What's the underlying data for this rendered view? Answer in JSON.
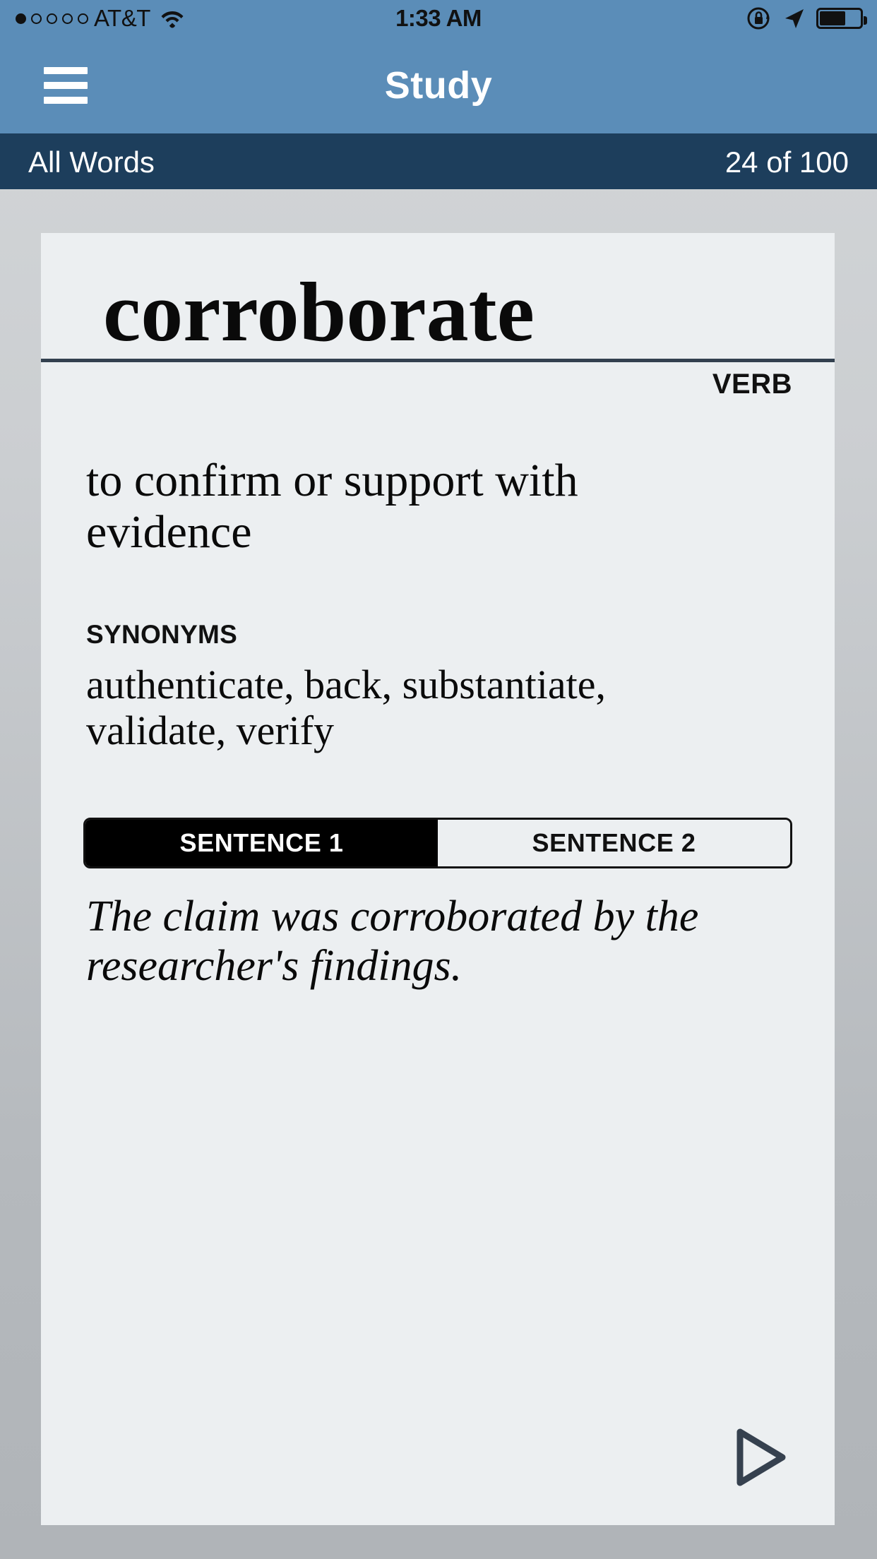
{
  "status_bar": {
    "carrier": "AT&T",
    "signal_dots_total": 5,
    "signal_dots_filled": 1,
    "wifi_icon": "wifi-icon",
    "time": "1:33 AM",
    "rotation_lock_icon": "rotation-lock-icon",
    "location_icon": "location-arrow-icon",
    "battery_icon": "battery-icon",
    "battery_percent": 65
  },
  "nav": {
    "menu_icon": "hamburger-menu-icon",
    "title": "Study",
    "background_color": "#5b8db8"
  },
  "sub_header": {
    "list_name": "All Words",
    "progress": "24 of 100",
    "background_color": "#1d3e5c"
  },
  "card": {
    "word": "corroborate",
    "part_of_speech": "VERB",
    "definition": "to confirm or support with evidence",
    "synonyms_label": "SYNONYMS",
    "synonyms": "authenticate, back, substantiate, validate, verify",
    "segments": [
      {
        "label": "SENTENCE 1",
        "active": true
      },
      {
        "label": "SENTENCE 2",
        "active": false
      }
    ],
    "sentence": "The claim was corroborated by the researcher's findings.",
    "next_icon": "play-triangle-next-icon",
    "next_icon_color": "#36414f",
    "background_color": "#eceff1"
  }
}
